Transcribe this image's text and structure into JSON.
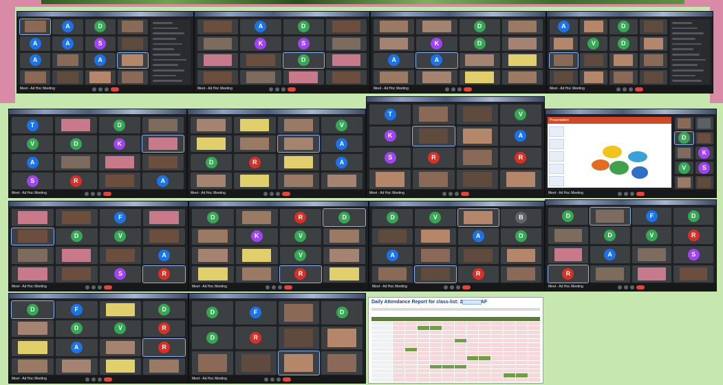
{
  "meet_caption": "Meet - Ad Hoc Meeting",
  "report": {
    "title": "Daily Attendance Report for class-list: 2022-AA-AF"
  },
  "presentation": {
    "slide_title": "Presentation"
  },
  "colors": {
    "background": "#c6e7ad",
    "frame": "#d98aa6",
    "meet_dark": "#202124",
    "tile": "#3c4043",
    "hangup": "#ea4335",
    "present": "#6f9e43",
    "absent": "#f8d7da"
  },
  "screenshots": [
    {
      "name": "meet-shot-r1-1",
      "cols": 4,
      "rows": 4,
      "side": true,
      "tiles": [
        "v",
        "A",
        "D",
        "v",
        "A",
        "A",
        "S",
        "v",
        "A",
        "v",
        "A",
        "v",
        "v",
        "v",
        "v",
        "v"
      ]
    },
    {
      "name": "meet-shot-r1-2",
      "cols": 4,
      "rows": 4,
      "tiles": [
        "v",
        "A",
        "D",
        "v",
        "v",
        "K",
        "S",
        "v",
        "v",
        "v",
        "D",
        "v",
        "v",
        "v",
        "v",
        "v"
      ]
    },
    {
      "name": "meet-shot-r1-3",
      "cols": 4,
      "rows": 4,
      "tiles": [
        "v",
        "v",
        "D",
        "v",
        "v",
        "K",
        "D",
        "v",
        "A",
        "A",
        "v",
        "v",
        "v",
        "v",
        "v",
        "v"
      ]
    },
    {
      "name": "meet-shot-r1-4",
      "cols": 4,
      "rows": 4,
      "side": true,
      "tiles": [
        "A",
        "v",
        "D",
        "v",
        "v",
        "V",
        "D",
        "v",
        "v",
        "v",
        "v",
        "v",
        "v",
        "v",
        "v",
        "v"
      ]
    },
    {
      "name": "meet-shot-r2-1",
      "cols": 4,
      "rows": 4,
      "tiles": [
        "T",
        "v",
        "D",
        "v",
        "V",
        "D",
        "K",
        "v",
        "A",
        "v",
        "v",
        "v",
        "S",
        "R",
        "v",
        "A"
      ]
    },
    {
      "name": "meet-shot-r2-2",
      "cols": 4,
      "rows": 4,
      "tiles": [
        "v",
        "v",
        "v",
        "V",
        "v",
        "v",
        "v",
        "A",
        "D",
        "R",
        "v",
        "A",
        "v",
        "v",
        "v",
        "v"
      ]
    },
    {
      "name": "meet-shot-r2-3",
      "cols": 4,
      "rows": 4,
      "tiles": [
        "T",
        "v",
        "v",
        "V",
        "K",
        "v",
        "v",
        "A",
        "S",
        "R",
        "v",
        "R",
        "v",
        "v",
        "v",
        "v"
      ]
    },
    {
      "name": "meet-shot-r3-1",
      "cols": 4,
      "rows": 4,
      "tiles": [
        "v",
        "v",
        "F",
        "v",
        "v",
        "D",
        "V",
        "v",
        "v",
        "v",
        "v",
        "A",
        "v",
        "v",
        "S",
        "R"
      ]
    },
    {
      "name": "meet-shot-r3-2",
      "cols": 4,
      "rows": 4,
      "tiles": [
        "D",
        "v",
        "R",
        "D",
        "v",
        "K",
        "V",
        "v",
        "v",
        "v",
        "V",
        "v",
        "v",
        "v",
        "R",
        "v"
      ]
    },
    {
      "name": "meet-shot-r3-3",
      "cols": 4,
      "rows": 4,
      "tiles": [
        "D",
        "V",
        "v",
        "B",
        "v",
        "v",
        "A",
        "D",
        "A",
        "v",
        "v",
        "v",
        "v",
        "v",
        "R",
        "v"
      ]
    },
    {
      "name": "meet-shot-r3-4",
      "cols": 4,
      "rows": 4,
      "tiles": [
        "D",
        "v",
        "F",
        "D",
        "v",
        "D",
        "V",
        "R",
        "v",
        "A",
        "v",
        "S",
        "R",
        "v",
        "v",
        "v"
      ]
    },
    {
      "name": "meet-shot-r4-1",
      "cols": 4,
      "rows": 4,
      "tiles": [
        "D",
        "F",
        "v",
        "D",
        "v",
        "D",
        "V",
        "R",
        "v",
        "A",
        "v",
        "R",
        "v",
        "v",
        "v",
        "v"
      ]
    },
    {
      "name": "meet-shot-r4-2",
      "cols": 4,
      "rows": 3,
      "tiles": [
        "D",
        "F",
        "v",
        "D",
        "D",
        "R",
        "v",
        "v",
        "v",
        "v",
        "v",
        "v"
      ]
    }
  ]
}
